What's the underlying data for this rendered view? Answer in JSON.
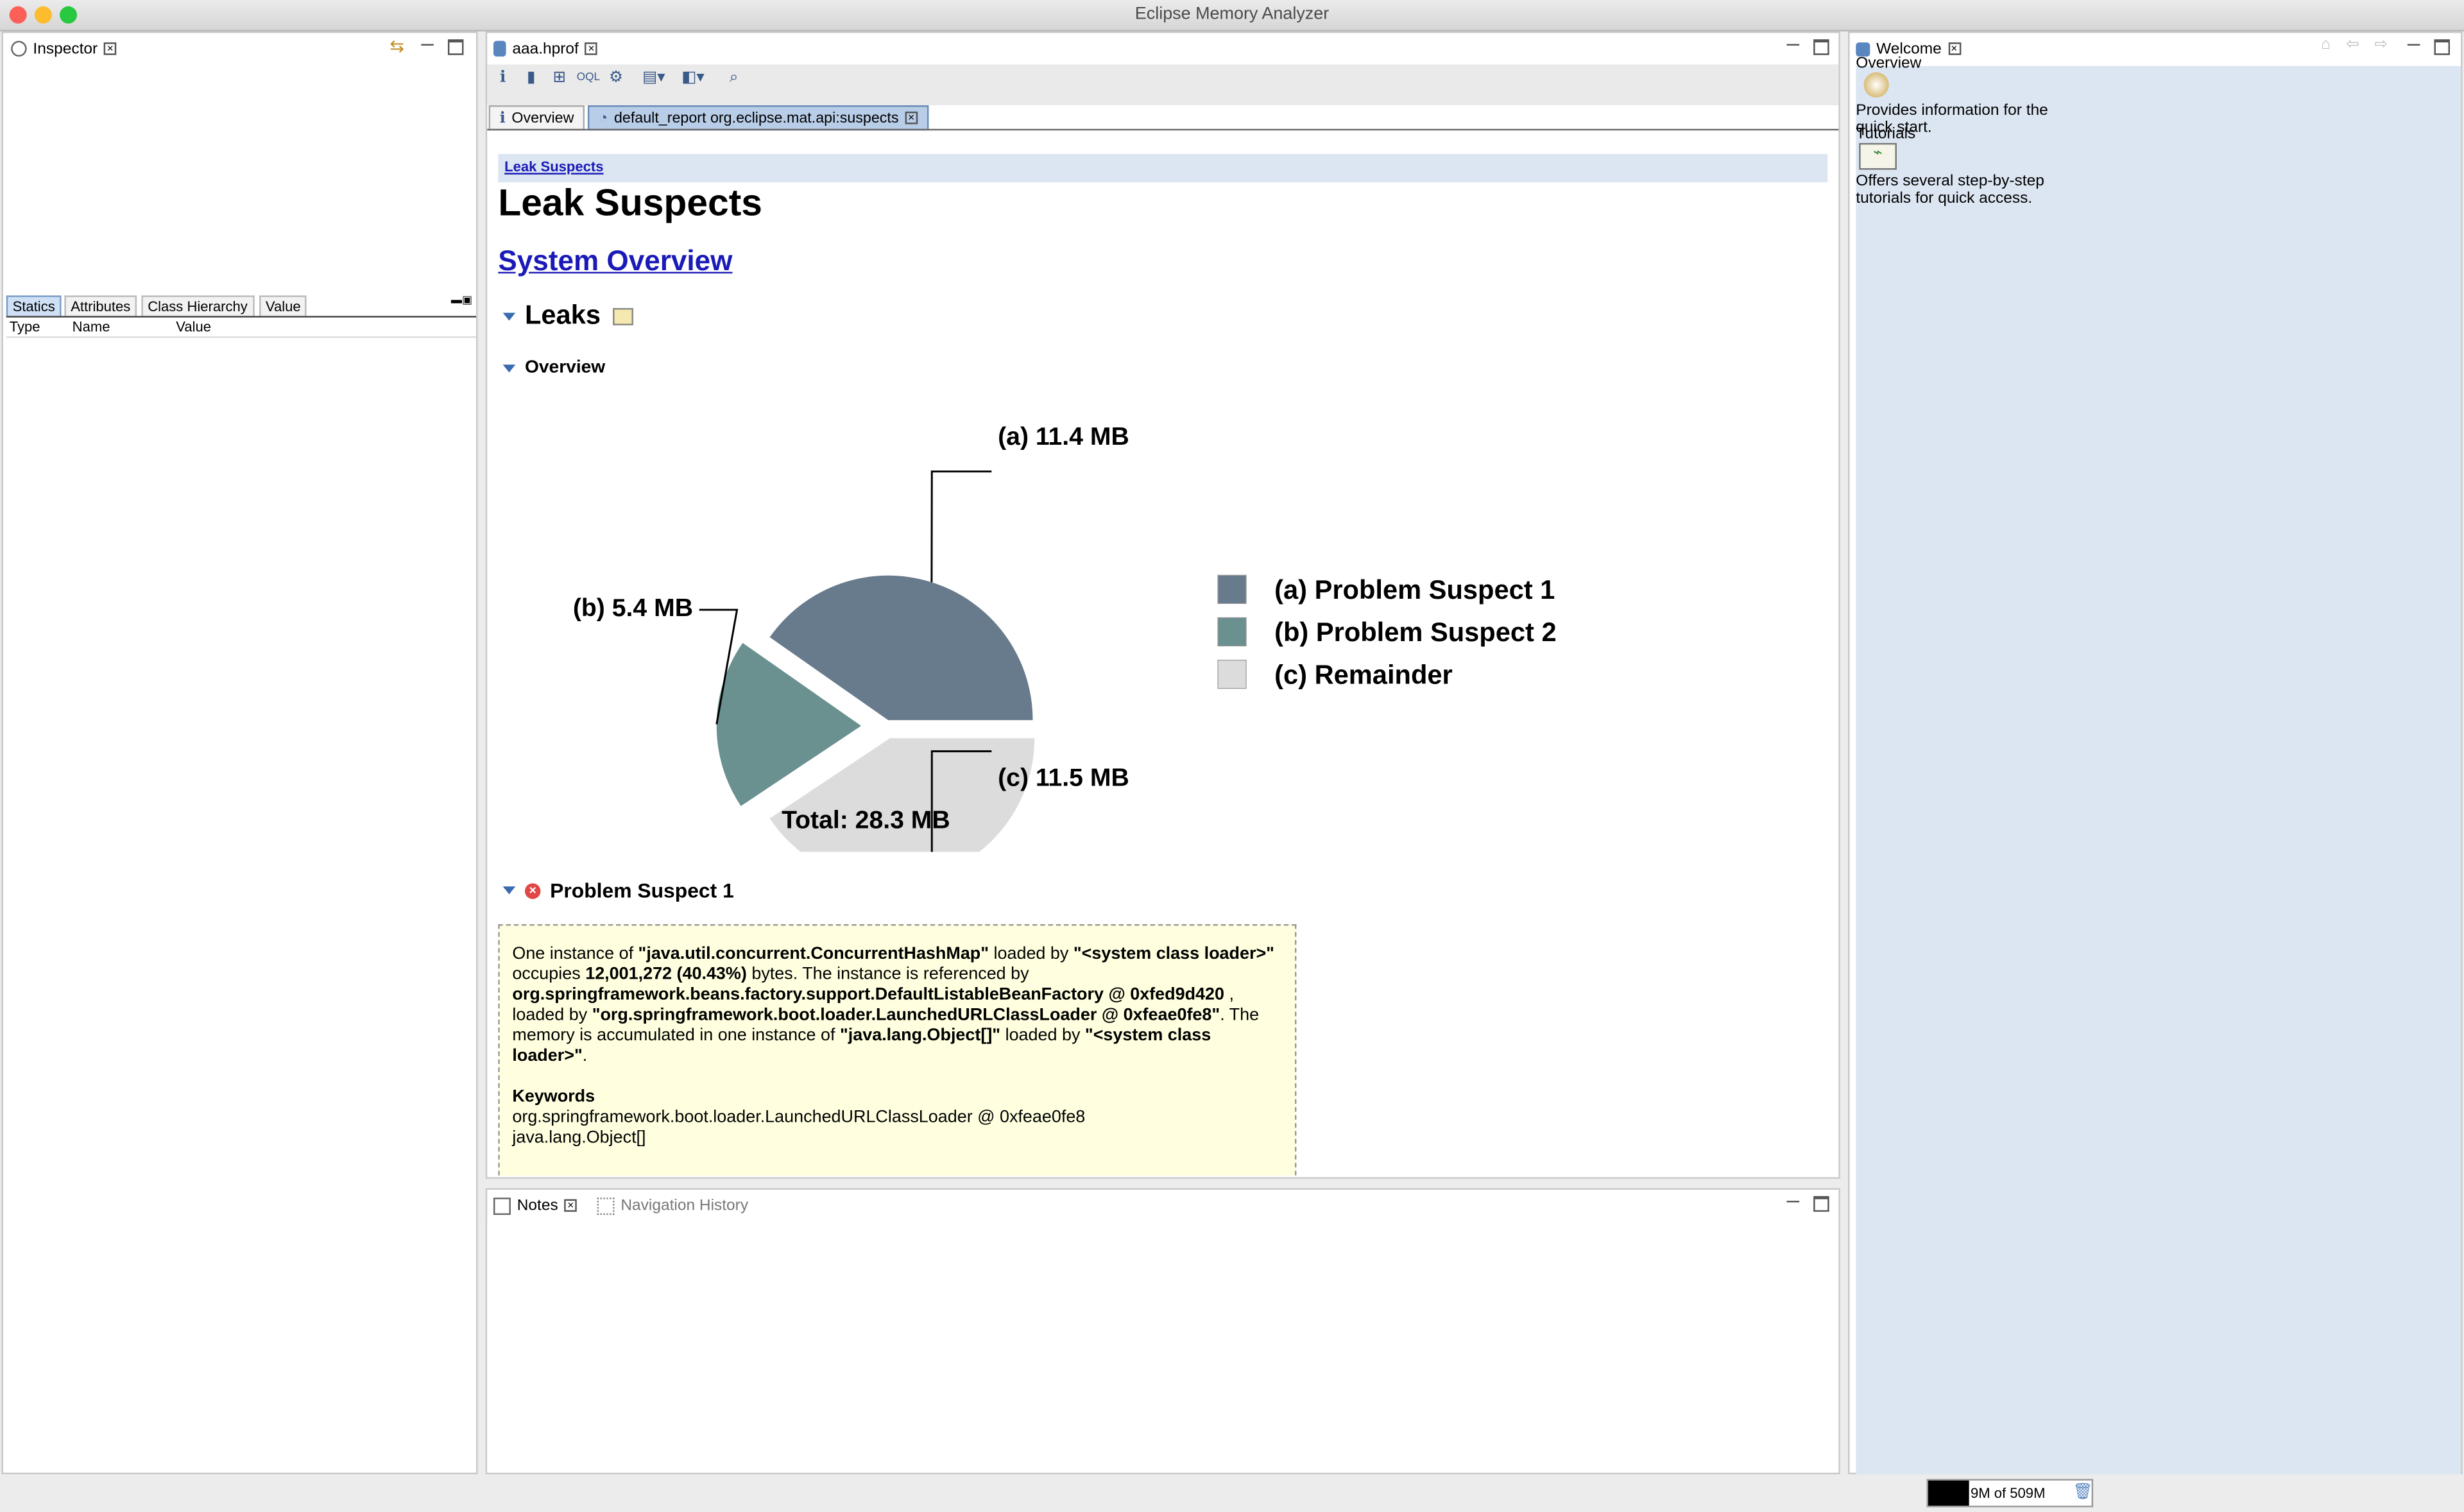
{
  "window": {
    "title": "Eclipse Memory Analyzer"
  },
  "inspector": {
    "tab_label": "Inspector",
    "subtabs": [
      "Statics",
      "Attributes",
      "Class Hierarchy",
      "Value"
    ],
    "columns": [
      "Type",
      "Name",
      "Value"
    ]
  },
  "editor": {
    "file_tab": "aaa.hprof",
    "tabs": [
      {
        "label": "Overview",
        "active": false
      },
      {
        "label": "default_report  org.eclipse.mat.api:suspects",
        "active": true
      }
    ],
    "toolbar_icons": [
      "info-icon",
      "histogram-icon",
      "dominator-tree-icon",
      "oql-icon",
      "thread-overview-icon",
      "run-report-icon",
      "query-browser-icon",
      "search-icon"
    ]
  },
  "report": {
    "breadcrumb": "Leak Suspects",
    "title": "Leak Suspects",
    "system_overview_link": "System Overview",
    "leaks_heading": "Leaks",
    "overview_heading": "Overview",
    "problem_heading": "Problem Suspect 1",
    "problem_text": {
      "p1": "One instance of ",
      "b1": "\"java.util.concurrent.ConcurrentHashMap\"",
      "p2": " loaded by ",
      "b2": "\"<system class loader>\"",
      "p3": " occupies ",
      "b3": "12,001,272 (40.43%)",
      "p4": " bytes. The instance is referenced by ",
      "b4": "org.springframework.beans.factory.support.DefaultListableBeanFactory @ 0xfed9d420",
      "p5": " , loaded by ",
      "b5": "\"org.springframework.boot.loader.LaunchedURLClassLoader @ 0xfeae0fe8\"",
      "p6": ". The memory is accumulated in one instance of ",
      "b6": "\"java.lang.Object[]\"",
      "p7": " loaded by ",
      "b7": "\"<system class loader>\"",
      "p8": ".",
      "keywords_label": "Keywords",
      "keyword1": "org.springframework.boot.loader.LaunchedURLClassLoader @ 0xfeae0fe8",
      "keyword2": "java.lang.Object[]"
    }
  },
  "chart_data": {
    "type": "pie",
    "total_label": "Total: 28.3 MB",
    "slices": [
      {
        "key": "(a)",
        "value": 11.4,
        "value_label": "11.4 MB",
        "legend": "Problem Suspect 1",
        "color": "#687b8d"
      },
      {
        "key": "(b)",
        "value": 5.4,
        "value_label": "5.4 MB",
        "legend": "Problem Suspect 2",
        "color": "#6a9090"
      },
      {
        "key": "(c)",
        "value": 11.5,
        "value_label": "11.5 MB",
        "legend": "Remainder",
        "color": "#dcdcdc"
      }
    ]
  },
  "notes": {
    "tab_label": "Notes",
    "nav_history_label": "Navigation History"
  },
  "welcome": {
    "tab_label": "Welcome",
    "overview_label": "Overview",
    "overview_desc": "Provides information for the quick start.",
    "tutorials_label": "Tutorials",
    "tutorials_desc": "Offers several step-by-step tutorials for quick access."
  },
  "status": {
    "heap": "9M of 509M"
  }
}
